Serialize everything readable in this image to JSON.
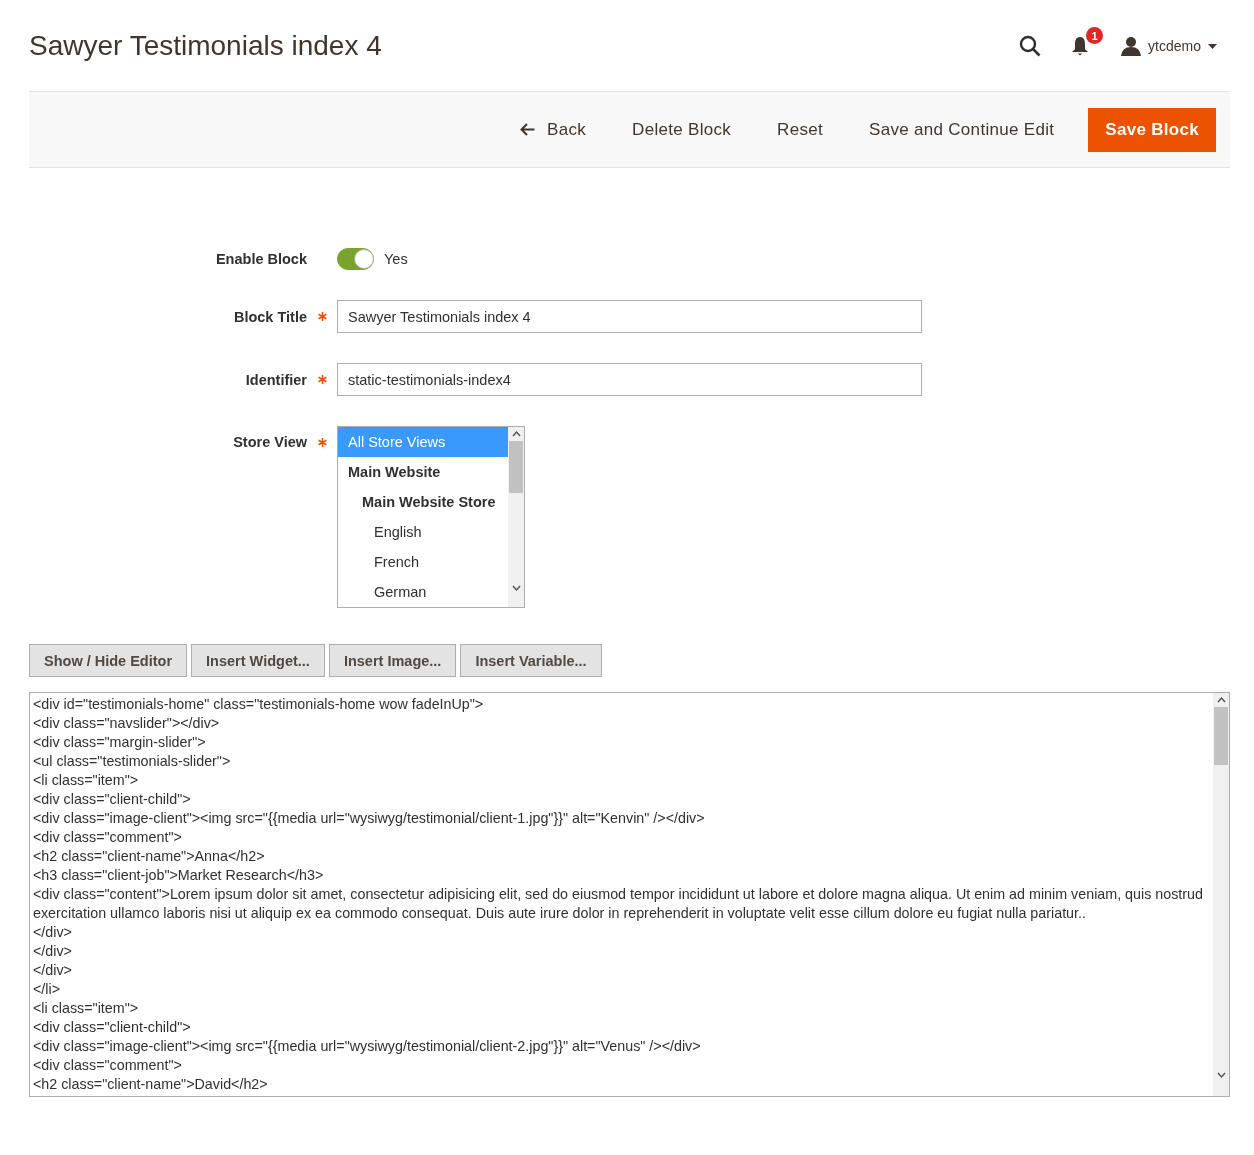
{
  "page_title": "Sawyer Testimonials index 4",
  "header": {
    "notification_count": "1",
    "user": "ytcdemo"
  },
  "actions": [
    {
      "label": "Back",
      "kind": "back"
    },
    {
      "label": "Delete Block",
      "kind": "plain"
    },
    {
      "label": "Reset",
      "kind": "plain"
    },
    {
      "label": "Save and Continue Edit",
      "kind": "plain"
    },
    {
      "label": "Save Block",
      "kind": "primary"
    }
  ],
  "form": {
    "enable_block": {
      "label": "Enable Block",
      "on": true,
      "value_label": "Yes"
    },
    "block_title": {
      "label": "Block Title",
      "required": true,
      "value": "Sawyer Testimonials index 4"
    },
    "identifier": {
      "label": "Identifier",
      "required": true,
      "value": "static-testimonials-index4"
    },
    "store_view": {
      "label": "Store View",
      "required": true,
      "options": [
        {
          "label": "All Store Views",
          "selected": true
        },
        {
          "label": "Main Website",
          "selected": false,
          "children": [
            {
              "label": "Main Website Store",
              "selected": false,
              "children": [
                {
                  "label": "English",
                  "selected": false
                },
                {
                  "label": "French",
                  "selected": false
                },
                {
                  "label": "German",
                  "selected": false
                }
              ]
            }
          ]
        }
      ]
    }
  },
  "editor_buttons": [
    "Show / Hide Editor",
    "Insert Widget...",
    "Insert Image...",
    "Insert Variable..."
  ],
  "editor_lines": [
    "<div id=\"testimonials-home\" class=\"testimonials-home wow fadeInUp\">",
    "<div class=\"navslider\"></div>",
    "<div class=\"margin-slider\">",
    "<ul class=\"testimonials-slider\">",
    "<li class=\"item\">",
    "<div class=\"client-child\">",
    "<div class=\"image-client\"><img src=\"{{media url=\"wysiwyg/testimonial/client-1.jpg\"}}\" alt=\"Kenvin\" /></div>",
    "<div class=\"comment\">",
    "<h2 class=\"client-name\">Anna</h2>",
    "<h3 class=\"client-job\">Market Research</h3>",
    "<div class=\"content\">Lorem ipsum dolor sit amet, consectetur adipisicing elit, sed do eiusmod tempor incididunt ut labore et dolore magna aliqua. Ut enim ad minim veniam, quis nostrud exercitation ullamco laboris nisi ut aliquip ex ea commodo consequat. Duis aute irure dolor in reprehenderit in voluptate velit esse cillum dolore eu fugiat nulla pariatur..",
    "</div>",
    "</div>",
    "</div>",
    "</li>",
    "<li class=\"item\">",
    "<div class=\"client-child\">",
    "<div class=\"image-client\"><img src=\"{{media url=\"wysiwyg/testimonial/client-2.jpg\"}}\" alt=\"Venus\" /></div>",
    "<div class=\"comment\">",
    "<h2 class=\"client-name\">David</h2>"
  ]
}
